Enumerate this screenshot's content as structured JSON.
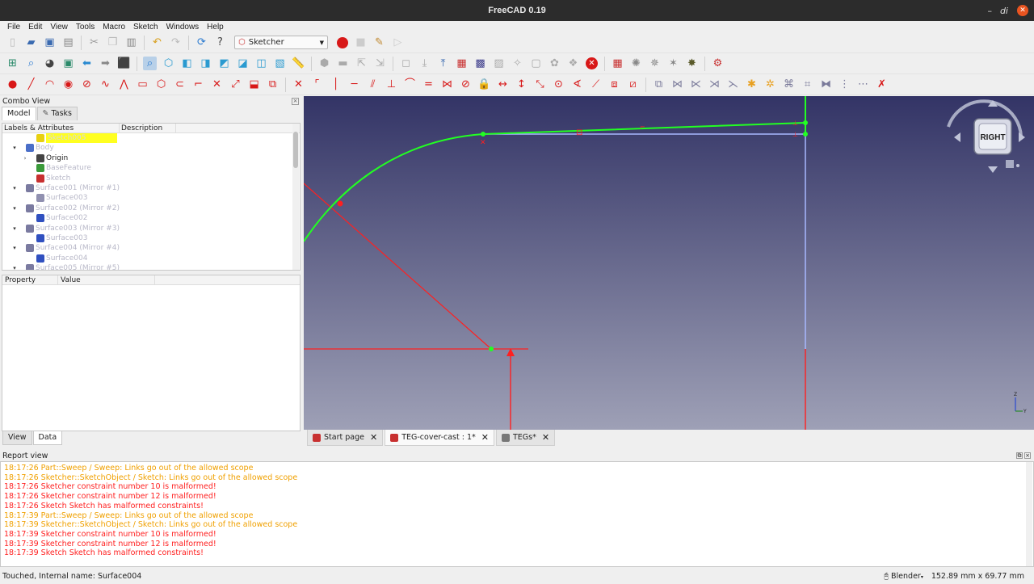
{
  "window": {
    "title": "FreeCAD 0.19",
    "ctl_label": "di"
  },
  "menu": [
    "File",
    "Edit",
    "View",
    "Tools",
    "Macro",
    "Sketch",
    "Windows",
    "Help"
  ],
  "workbench": "Sketcher",
  "combo": {
    "title": "Combo View",
    "tabs": [
      "Model",
      "Tasks"
    ],
    "tree_headers": [
      "Labels & Attributes",
      "Description"
    ],
    "tree": [
      {
        "label": "Sketch005",
        "selected": true,
        "indent": 3,
        "arrow": "",
        "icon_color": "#e8d010"
      },
      {
        "label": "Body",
        "indent": 2,
        "arrow": "▾",
        "icon_color": "#4a6ec8"
      },
      {
        "label": "Origin",
        "indent": 3,
        "arrow": "›",
        "icon_color": "#444444",
        "normal": true
      },
      {
        "label": "BaseFeature",
        "indent": 3,
        "arrow": "",
        "icon_color": "#3a9a3a"
      },
      {
        "label": "Sketch",
        "indent": 3,
        "arrow": "",
        "icon_color": "#c83030"
      },
      {
        "label": "Surface001 (Mirror #1)",
        "indent": 2,
        "arrow": "▾",
        "icon_color": "#7a7aa0"
      },
      {
        "label": "Surface003",
        "indent": 3,
        "arrow": "",
        "icon_color": "#9090b0"
      },
      {
        "label": "Surface002 (Mirror #2)",
        "indent": 2,
        "arrow": "▾",
        "icon_color": "#7a7aa0"
      },
      {
        "label": "Surface002",
        "indent": 3,
        "arrow": "",
        "icon_color": "#3050c0"
      },
      {
        "label": "Surface003 (Mirror #3)",
        "indent": 2,
        "arrow": "▾",
        "icon_color": "#7a7aa0"
      },
      {
        "label": "Surface003",
        "indent": 3,
        "arrow": "",
        "icon_color": "#3050c0"
      },
      {
        "label": "Surface004 (Mirror #4)",
        "indent": 2,
        "arrow": "▾",
        "icon_color": "#7a7aa0"
      },
      {
        "label": "Surface004",
        "indent": 3,
        "arrow": "",
        "icon_color": "#3050c0"
      },
      {
        "label": "Surface005 (Mirror #5)",
        "indent": 2,
        "arrow": "▾",
        "icon_color": "#7a7aa0"
      }
    ],
    "props_headers": [
      "Property",
      "Value"
    ],
    "bottom_tabs": [
      "View",
      "Data"
    ]
  },
  "navcube": {
    "face": "RIGHT"
  },
  "doc_tabs": [
    {
      "label": "Start page",
      "active": false,
      "icon_color": "#c83030"
    },
    {
      "label": "TEG-cover-cast : 1*",
      "active": true,
      "icon_color": "#c83030"
    },
    {
      "label": "TEGs*",
      "active": false,
      "icon_color": "#777777"
    }
  ],
  "report": {
    "title": "Report view",
    "lines": [
      {
        "text": "18:17:26  Part::Sweep / Sweep: Links go out of the allowed scope",
        "color": "#f0a000"
      },
      {
        "text": "18:17:26  Sketcher::SketchObject / Sketch: Links go out of the allowed scope",
        "color": "#f0a000"
      },
      {
        "text": "18:17:26  Sketcher constraint number 10 is malformed!",
        "color": "#ff2020"
      },
      {
        "text": "18:17:26  Sketcher constraint number 12 is malformed!",
        "color": "#ff2020"
      },
      {
        "text": "18:17:26  Sketch Sketch has malformed constraints!",
        "color": "#ff2020"
      },
      {
        "text": "18:17:39  Part::Sweep / Sweep: Links go out of the allowed scope",
        "color": "#f0a000"
      },
      {
        "text": "18:17:39  Sketcher::SketchObject / Sketch: Links go out of the allowed scope",
        "color": "#f0a000"
      },
      {
        "text": "18:17:39  Sketcher constraint number 10 is malformed!",
        "color": "#ff2020"
      },
      {
        "text": "18:17:39  Sketcher constraint number 12 is malformed!",
        "color": "#ff2020"
      },
      {
        "text": "18:17:39  Sketch Sketch has malformed constraints!",
        "color": "#ff2020"
      }
    ]
  },
  "status": {
    "message": "Touched, Internal name: Surface004",
    "nav_style": "Blender",
    "dimensions": "152.89 mm x 69.77 mm"
  },
  "colors": {
    "sketch_green": "#22ff22",
    "construction_red": "#ff2020",
    "edge_blue": "#a8b8ff",
    "view_top": "#333466",
    "view_bottom": "#9ea0b6"
  }
}
